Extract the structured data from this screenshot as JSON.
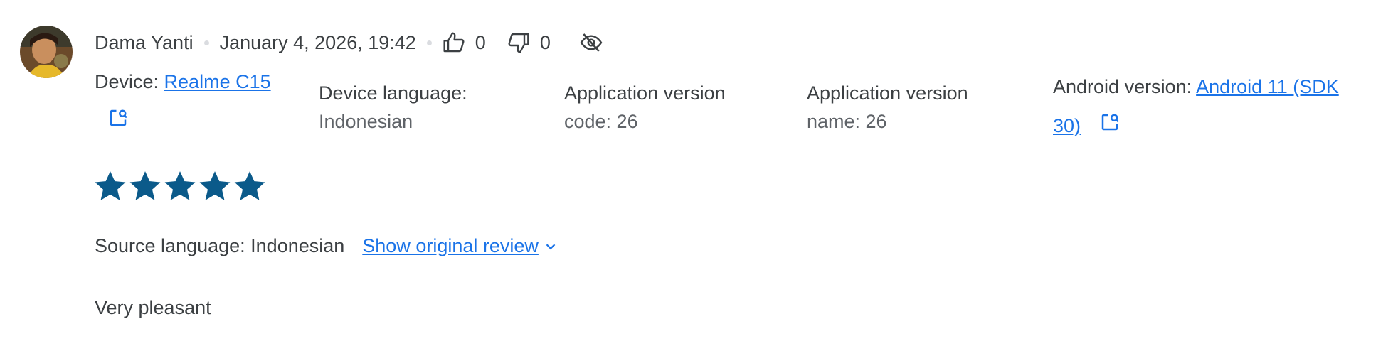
{
  "reviewer": {
    "name": "Dama Yanti",
    "date": "January 4, 2026, 19:42",
    "thumbs_up_count": "0",
    "thumbs_down_count": "0",
    "avatar_icon": "user-avatar-photo"
  },
  "meta": {
    "device_label": "Device: ",
    "device_value": "Realme C15",
    "device_language_label": "Device language:",
    "device_language_value": "Indonesian",
    "app_version_code_label": "Application version",
    "app_version_code_value": "code: 26",
    "app_version_name_label": "Application version",
    "app_version_name_value": "name: 26",
    "android_version_label": "Android version: ",
    "android_version_value_line1": "Android 11 (SDK",
    "android_version_value_line2": "30)"
  },
  "rating": {
    "stars": 5,
    "max": 5,
    "color": "#0b5a8a"
  },
  "source": {
    "label": "Source language: Indonesian",
    "show_original": "Show original review"
  },
  "review_text": "Very pleasant",
  "colors": {
    "link": "#1a73e8",
    "text": "#3c4043",
    "star": "#0b5a8a"
  }
}
